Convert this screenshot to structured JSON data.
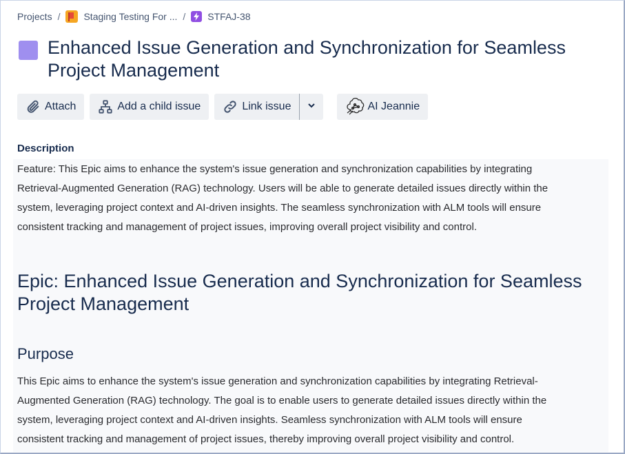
{
  "breadcrumb": {
    "projects": "Projects",
    "separator": "/",
    "project_name": "Staging Testing For ...",
    "issue_key": "STFAJ-38"
  },
  "issue": {
    "title": "Enhanced Issue Generation and Synchronization for Seamless Project Management",
    "swatch_color": "#9f8fef"
  },
  "toolbar": {
    "attach": "Attach",
    "add_child": "Add a child issue",
    "link_issue": "Link issue",
    "ai": "AI Jeannie",
    "icons": [
      "paperclip-icon",
      "hierarchy-icon",
      "link-icon",
      "chevron-down-icon",
      "ai-brain-icon"
    ]
  },
  "description": {
    "label": "Description",
    "feature_lines": [
      "Feature: This Epic aims to enhance the system's issue generation and synchronization capabilities by integrating",
      "Retrieval-Augmented Generation (RAG) technology. Users will be able to generate detailed issues directly within the",
      "system, leveraging project context and AI-driven insights. The seamless synchronization with ALM tools will ensure",
      "consistent tracking and management of project issues, improving overall project visibility and control."
    ],
    "epic_heading": "Epic: Enhanced Issue Generation and Synchronization for Seamless Project Management",
    "purpose_heading": "Purpose",
    "purpose_lines": [
      "This Epic aims to enhance the system's issue generation and synchronization capabilities by integrating Retrieval-",
      "Augmented Generation (RAG) technology. The goal is to enable users to generate detailed issues directly within the",
      "system, leveraging project context and AI-driven insights. Seamless synchronization with ALM tools will ensure",
      "consistent tracking and management of project issues, thereby improving overall project visibility and control."
    ]
  }
}
